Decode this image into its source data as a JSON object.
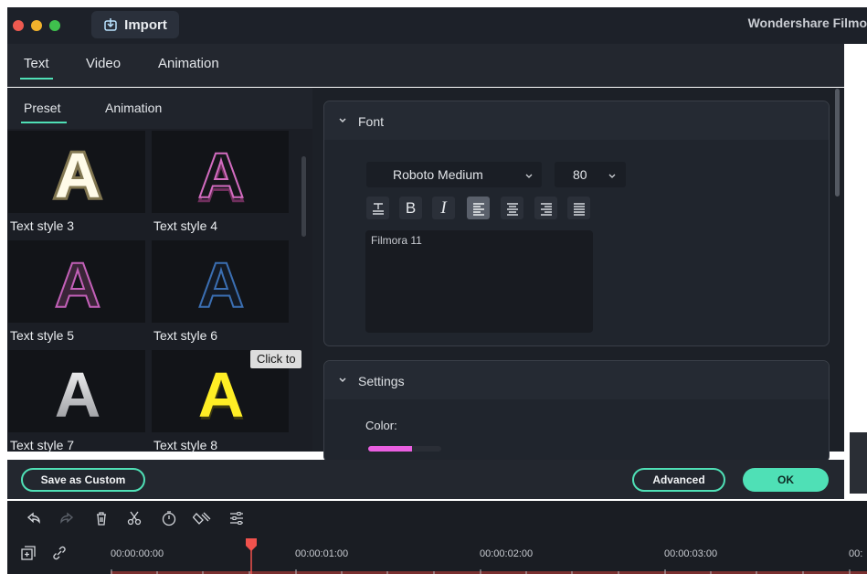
{
  "titlebar": {
    "import_label": "Import",
    "app_title": "Wondershare Filmo",
    "colors": {
      "close": "#ee5a50",
      "minimize": "#f1b22c",
      "maximize": "#3fc04d"
    }
  },
  "top_tabs": [
    {
      "label": "Text",
      "active": true
    },
    {
      "label": "Video",
      "active": false
    },
    {
      "label": "Animation",
      "active": false
    }
  ],
  "sub_tabs": [
    {
      "label": "Preset",
      "active": true
    },
    {
      "label": "Animation",
      "active": false
    }
  ],
  "presets": [
    {
      "label": "Text style 3",
      "style": "white-glow"
    },
    {
      "label": "Text style 4",
      "style": "pink-outline"
    },
    {
      "label": "Text style 5",
      "style": "violet-solid"
    },
    {
      "label": "Text style 6",
      "style": "blue-outline"
    },
    {
      "label": "Text style 7",
      "style": "silver"
    },
    {
      "label": "Text style 8",
      "style": "yellow"
    }
  ],
  "tooltip": "Click to",
  "font_panel": {
    "title": "Font",
    "font_name": "Roboto Medium",
    "font_size": "80",
    "text_value": "Filmora 11",
    "format_buttons": [
      "text-type-icon",
      "bold-icon",
      "italic-icon",
      "align-left-icon",
      "align-center-icon",
      "align-right-icon",
      "align-justify-icon"
    ],
    "active_align": "align-left-icon"
  },
  "settings_panel": {
    "title": "Settings",
    "color_label": "Color:",
    "color_value": "#e95fe0"
  },
  "buttons": {
    "save_custom": "Save as Custom",
    "advanced": "Advanced",
    "ok": "OK",
    "accent": "#4fe0b6"
  },
  "timeline": {
    "toolbar_icons": [
      "undo-icon",
      "redo-icon",
      "delete-icon",
      "cut-icon",
      "speed-icon",
      "keyframe-icon",
      "adjust-icon"
    ],
    "side_icons": [
      "add-track-icon",
      "link-icon"
    ],
    "timecodes": [
      "00:00:00:00",
      "00:00:01:00",
      "00:00:02:00",
      "00:00:03:00",
      "00:"
    ],
    "playhead_color": "#f0524d"
  }
}
